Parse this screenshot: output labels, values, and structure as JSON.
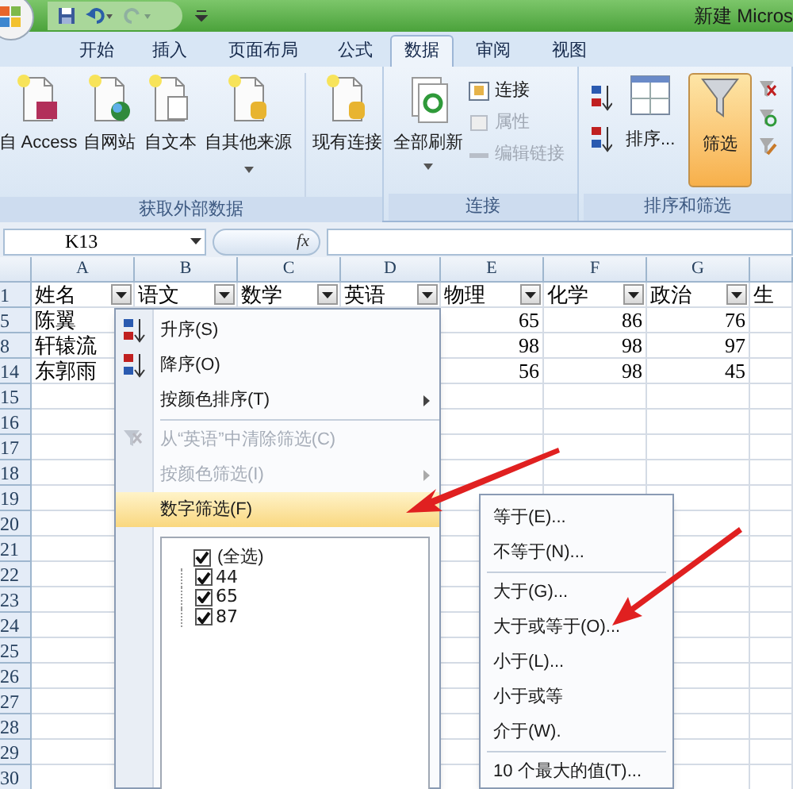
{
  "title_bar": {
    "title": "新建 Micros"
  },
  "ribbon_tabs": [
    {
      "label": "开始",
      "selected": false
    },
    {
      "label": "插入",
      "selected": false
    },
    {
      "label": "页面布局",
      "selected": false
    },
    {
      "label": "公式",
      "selected": false
    },
    {
      "label": "数据",
      "selected": true
    },
    {
      "label": "审阅",
      "selected": false
    },
    {
      "label": "视图",
      "selected": false
    }
  ],
  "get_external_data": {
    "label": "获取外部数据",
    "buttons": [
      "自 Access",
      "自网站",
      "自文本",
      "自其他来源",
      "现有连接"
    ]
  },
  "connections": {
    "label": "连接",
    "refresh_all": "全部刷新",
    "items": [
      {
        "label": "连接",
        "disabled": false
      },
      {
        "label": "属性",
        "disabled": true
      },
      {
        "label": "编辑链接",
        "disabled": true
      }
    ]
  },
  "sort_filter": {
    "label": "排序和筛选",
    "sort": "排序...",
    "filter": {
      "label": "筛选",
      "on": true
    }
  },
  "formula_bar": {
    "name_box": "K13",
    "fx": "fx"
  },
  "sheet": {
    "columns": [
      "A",
      "B",
      "C",
      "D",
      "E",
      "F",
      "G"
    ],
    "header_row": {
      "row": "1",
      "cells": [
        {
          "text": "姓名",
          "filter": true
        },
        {
          "text": "语文",
          "filter": true
        },
        {
          "text": "数学",
          "filter": true
        },
        {
          "text": "英语",
          "filter": true
        },
        {
          "text": "物理",
          "filter": true
        },
        {
          "text": "化学",
          "filter": true
        },
        {
          "text": "政治",
          "filter": true
        },
        {
          "text": "生",
          "filter": false
        }
      ]
    },
    "rows": [
      {
        "row": "5",
        "a": "陈翼",
        "e": "65",
        "f": "86",
        "g": "76"
      },
      {
        "row": "8",
        "a": "轩辕流",
        "e": "98",
        "f": "98",
        "g": "97"
      },
      {
        "row": "14",
        "a": "东郭雨",
        "e": "56",
        "f": "98",
        "g": "45"
      }
    ],
    "empty_rows": [
      "15",
      "16",
      "17",
      "18",
      "19",
      "20",
      "21",
      "22",
      "23",
      "24",
      "25",
      "26",
      "27",
      "28",
      "29",
      "30"
    ]
  },
  "filter_menu": {
    "items": [
      {
        "kind": "sort_ascending",
        "label": "升序(S)",
        "disabled": false,
        "submenu": false,
        "selected": false
      },
      {
        "kind": "sort_descending",
        "label": "降序(O)",
        "disabled": false,
        "submenu": false,
        "selected": false
      },
      {
        "kind": "command",
        "label": "按颜色排序(T)",
        "disabled": false,
        "submenu": true,
        "selected": false
      },
      {
        "kind": "separator"
      },
      {
        "kind": "clear_filter",
        "label": "从“英语”中清除筛选(C)",
        "disabled": true,
        "submenu": false,
        "selected": false
      },
      {
        "kind": "command",
        "label": "按颜色筛选(I)",
        "disabled": true,
        "submenu": true,
        "selected": false
      },
      {
        "kind": "command",
        "label": "数字筛选(F)",
        "disabled": false,
        "submenu": false,
        "selected": true
      }
    ],
    "values": [
      {
        "label": "(全选)",
        "checked": true,
        "kind": "all"
      },
      {
        "label": "44",
        "checked": true,
        "kind": "value"
      },
      {
        "label": "65",
        "checked": true,
        "kind": "value"
      },
      {
        "label": "87",
        "checked": true,
        "kind": "value"
      }
    ]
  },
  "number_filter_menu": {
    "items": [
      {
        "kind": "item",
        "label": "等于(E)..."
      },
      {
        "kind": "item",
        "label": "不等于(N)..."
      },
      {
        "kind": "separator"
      },
      {
        "kind": "item",
        "label": "大于(G)..."
      },
      {
        "kind": "item",
        "label": "大于或等于(O)..."
      },
      {
        "kind": "item",
        "label": "小于(L)..."
      },
      {
        "kind": "item",
        "label": "小于或等"
      },
      {
        "kind": "item",
        "label": "介于(W)."
      },
      {
        "kind": "separator"
      },
      {
        "kind": "item",
        "label": "10 个最大的值(T)..."
      }
    ]
  }
}
